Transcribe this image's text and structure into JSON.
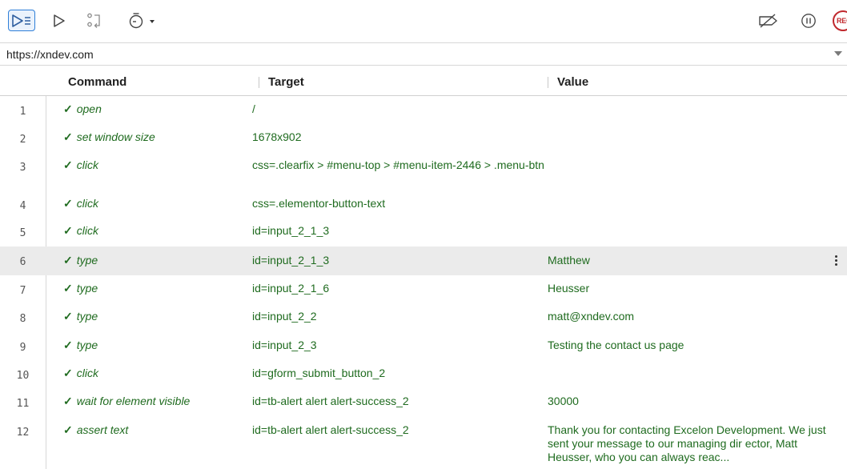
{
  "toolbar": {
    "buttons": [
      "run-all-tests",
      "run-current-test",
      "step-over",
      "test-execution-speed",
      "disable-breakpoints",
      "pause-on-exceptions",
      "start-recording"
    ],
    "record_label": "REC"
  },
  "url": {
    "value": "https://xndev.com"
  },
  "table": {
    "headers": {
      "command": "Command",
      "target": "Target",
      "value": "Value"
    },
    "rows": [
      {
        "num": "1",
        "command": "open",
        "target": "/",
        "value": ""
      },
      {
        "num": "2",
        "command": "set window size",
        "target": "1678x902",
        "value": ""
      },
      {
        "num": "3",
        "command": "click",
        "target": "css=.clearfix > #menu-top > #menu-item-2446 > .menu-btn",
        "value": ""
      },
      {
        "num": "4",
        "command": "click",
        "target": "css=.elementor-button-text",
        "value": ""
      },
      {
        "num": "5",
        "command": "click",
        "target": "id=input_2_1_3",
        "value": ""
      },
      {
        "num": "6",
        "command": "type",
        "target": "id=input_2_1_3",
        "value": "Matthew"
      },
      {
        "num": "7",
        "command": "type",
        "target": "id=input_2_1_6",
        "value": "Heusser"
      },
      {
        "num": "8",
        "command": "type",
        "target": "id=input_2_2",
        "value": "matt@xndev.com"
      },
      {
        "num": "9",
        "command": "type",
        "target": "id=input_2_3",
        "value": "Testing the contact us page"
      },
      {
        "num": "10",
        "command": "click",
        "target": "id=gform_submit_button_2",
        "value": ""
      },
      {
        "num": "11",
        "command": "wait for element visible",
        "target": "id=tb-alert alert alert-success_2",
        "value": "30000"
      },
      {
        "num": "12",
        "command": "assert text",
        "target": "id=tb-alert alert alert-success_2",
        "value": "Thank you for contacting Excelon Development. We just sent your message to our managing dir ector, Matt Heusser, who you can always reac..."
      }
    ],
    "selected_row": "6",
    "status_icon": "check-icon",
    "colors": {
      "passed_text": "#1f6b1f",
      "selected_bg": "#ebebeb",
      "accent": "#2f7fd8",
      "record": "#c0282d"
    }
  }
}
